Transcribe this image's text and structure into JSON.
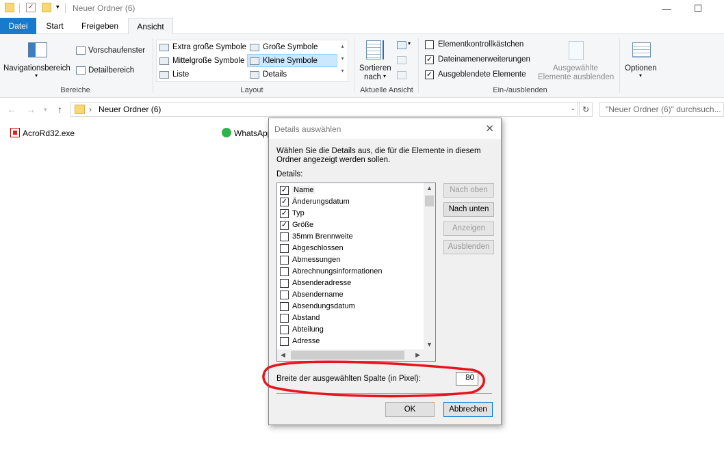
{
  "window": {
    "title": "Neuer Ordner (6)"
  },
  "tabs": [
    {
      "label": "Datei"
    },
    {
      "label": "Start"
    },
    {
      "label": "Freigeben"
    },
    {
      "label": "Ansicht"
    }
  ],
  "ribbon": {
    "bereiche": {
      "navigationsbereich": "Navigationsbereich",
      "vorschaufenster": "Vorschaufenster",
      "detailbereich": "Detailbereich",
      "label": "Bereiche"
    },
    "layout": {
      "items": [
        "Extra große Symbole",
        "Große Symbole",
        "Mittelgroße Symbole",
        "Kleine Symbole",
        "Liste",
        "Details"
      ],
      "label": "Layout"
    },
    "ansicht": {
      "sortieren": "Sortieren",
      "nach": "nach",
      "label": "Aktuelle Ansicht"
    },
    "einblenden": {
      "elementkontrollkaestchen": "Elementkontrollkästchen",
      "dateinamenerweiterungen": "Dateinamenerweiterungen",
      "ausgeblendete": "Ausgeblendete Elemente",
      "ausgewaehlte_1": "Ausgewählte",
      "ausgewaehlte_2": "Elemente ausblenden",
      "label": "Ein-/ausblenden"
    },
    "optionen": "Optionen"
  },
  "address": {
    "path": "Neuer Ordner (6)",
    "search_placeholder": "\"Neuer Ordner (6)\" durchsuch..."
  },
  "files": [
    {
      "name": "AcroRd32.exe"
    },
    {
      "name": "WhatsApp"
    }
  ],
  "dialog": {
    "title": "Details auswählen",
    "description": "Wählen Sie die Details aus, die für die Elemente in diesem Ordner angezeigt werden sollen.",
    "details_label": "Details:",
    "items": [
      {
        "label": "Name",
        "checked": true
      },
      {
        "label": "Änderungsdatum",
        "checked": true
      },
      {
        "label": "Typ",
        "checked": true
      },
      {
        "label": "Größe",
        "checked": true
      },
      {
        "label": "35mm Brennweite",
        "checked": false
      },
      {
        "label": "Abgeschlossen",
        "checked": false
      },
      {
        "label": "Abmessungen",
        "checked": false
      },
      {
        "label": "Abrechnungsinformationen",
        "checked": false
      },
      {
        "label": "Absenderadresse",
        "checked": false
      },
      {
        "label": "Absendername",
        "checked": false
      },
      {
        "label": "Absendungsdatum",
        "checked": false
      },
      {
        "label": "Abstand",
        "checked": false
      },
      {
        "label": "Abteilung",
        "checked": false
      },
      {
        "label": "Adresse",
        "checked": false
      }
    ],
    "buttons": {
      "nach_oben": "Nach oben",
      "nach_unten": "Nach unten",
      "anzeigen": "Anzeigen",
      "ausblenden": "Ausblenden",
      "ok": "OK",
      "abbrechen": "Abbrechen"
    },
    "width_label": "Breite der ausgewählten Spalte (in Pixel):",
    "width_value": "80"
  },
  "colors": {
    "accent": "#1979ca",
    "highlight_ring": "#e8141b",
    "selection": "#cce8ff"
  }
}
